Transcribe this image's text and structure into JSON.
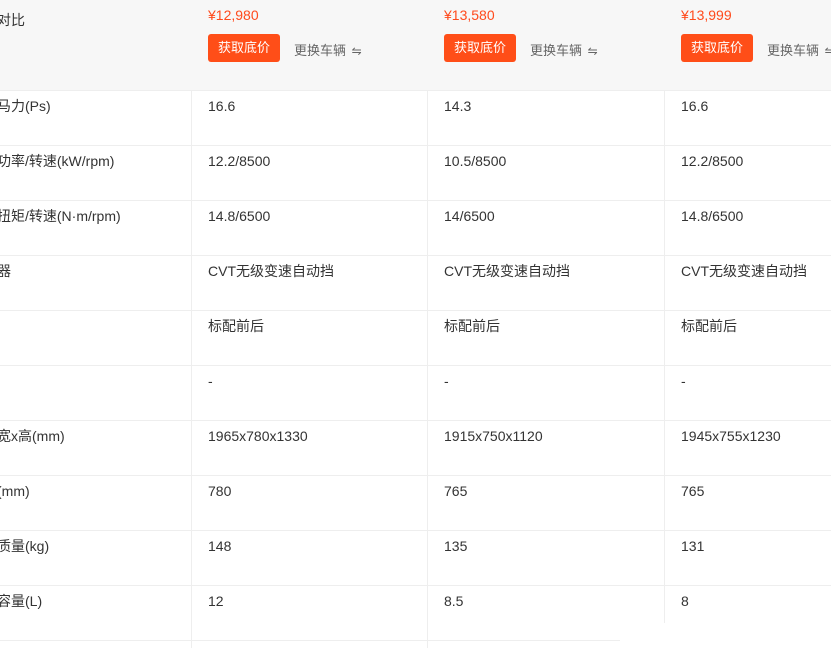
{
  "header": {
    "title": "对比",
    "columns": [
      {
        "price": "¥12,980",
        "button_label": "获取底价",
        "swap_label": "更换车辆",
        "swap_icon": "⇋"
      },
      {
        "price": "¥13,580",
        "button_label": "获取底价",
        "swap_label": "更换车辆",
        "swap_icon": "⇋"
      },
      {
        "price": "¥13,999",
        "button_label": "获取底价",
        "swap_label": "更换车辆",
        "swap_icon": "⇋"
      }
    ]
  },
  "rows": [
    {
      "label": "马力(Ps)",
      "values": [
        "16.6",
        "14.3",
        "16.6"
      ]
    },
    {
      "label": "功率/转速(kW/rpm)",
      "values": [
        "12.2/8500",
        "10.5/8500",
        "12.2/8500"
      ]
    },
    {
      "label": "扭矩/转速(N·m/rpm)",
      "values": [
        "14.8/6500",
        "14/6500",
        "14.8/6500"
      ]
    },
    {
      "label": "器",
      "values": [
        "CVT无级变速自动挡",
        "CVT无级变速自动挡",
        "CVT无级变速自动挡"
      ]
    },
    {
      "label": "",
      "values": [
        "标配前后",
        "标配前后",
        "标配前后"
      ]
    },
    {
      "label": "",
      "values": [
        "-",
        "-",
        "-"
      ]
    },
    {
      "label": "宽x高(mm)",
      "values": [
        "1965x780x1330",
        "1915x750x1120",
        "1945x755x1230"
      ]
    },
    {
      "label": "(mm)",
      "values": [
        "780",
        "765",
        "765"
      ]
    },
    {
      "label": "质量(kg)",
      "values": [
        "148",
        "135",
        "131"
      ]
    },
    {
      "label": "容量(L)",
      "values": [
        "12",
        "8.5",
        "8"
      ]
    }
  ],
  "colors": {
    "accent": "#ff4e18",
    "price": "#ff4a1c",
    "header_bg": "#f7f7f7",
    "divider": "#eeeeee"
  }
}
